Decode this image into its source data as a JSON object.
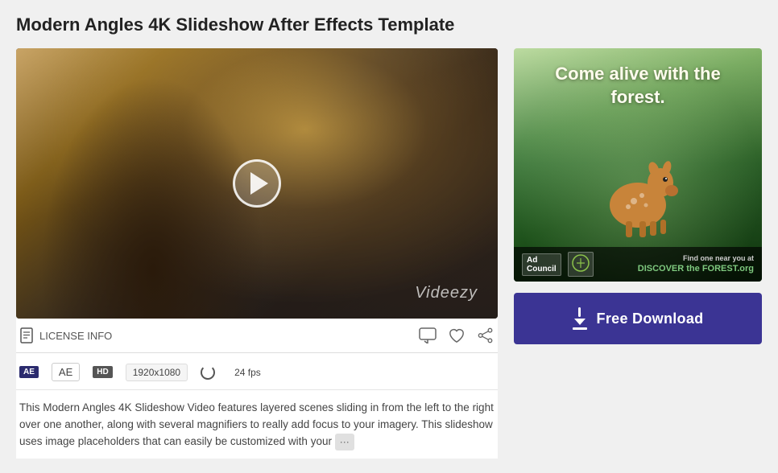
{
  "page": {
    "title": "Modern Angles 4K Slideshow After Effects Template"
  },
  "video": {
    "watermark": "Videezy",
    "play_label": "Play video"
  },
  "toolbar": {
    "license_label": "LICENSE INFO",
    "comment_icon": "comment-icon",
    "like_icon": "heart-icon",
    "share_icon": "share-icon"
  },
  "meta": {
    "ae_label": "AE",
    "hd_label": "HD",
    "resolution": "1920x1080",
    "fps": "24 fps"
  },
  "description": {
    "text": "This Modern Angles 4K Slideshow Video features layered scenes sliding in from the left to the right over one another, along with several magnifiers to really add focus to your imagery. This slideshow uses image placeholders that can easily be customized with your",
    "more_label": "···"
  },
  "ad": {
    "headline": "Come alive with the forest.",
    "footer_label1": "Ad",
    "footer_label2": "Council",
    "discover_pre": "Find one near you at",
    "discover_main": "DISCOVER the FOREST.org"
  },
  "download": {
    "label": "Free Download",
    "icon_label": "download-icon"
  }
}
